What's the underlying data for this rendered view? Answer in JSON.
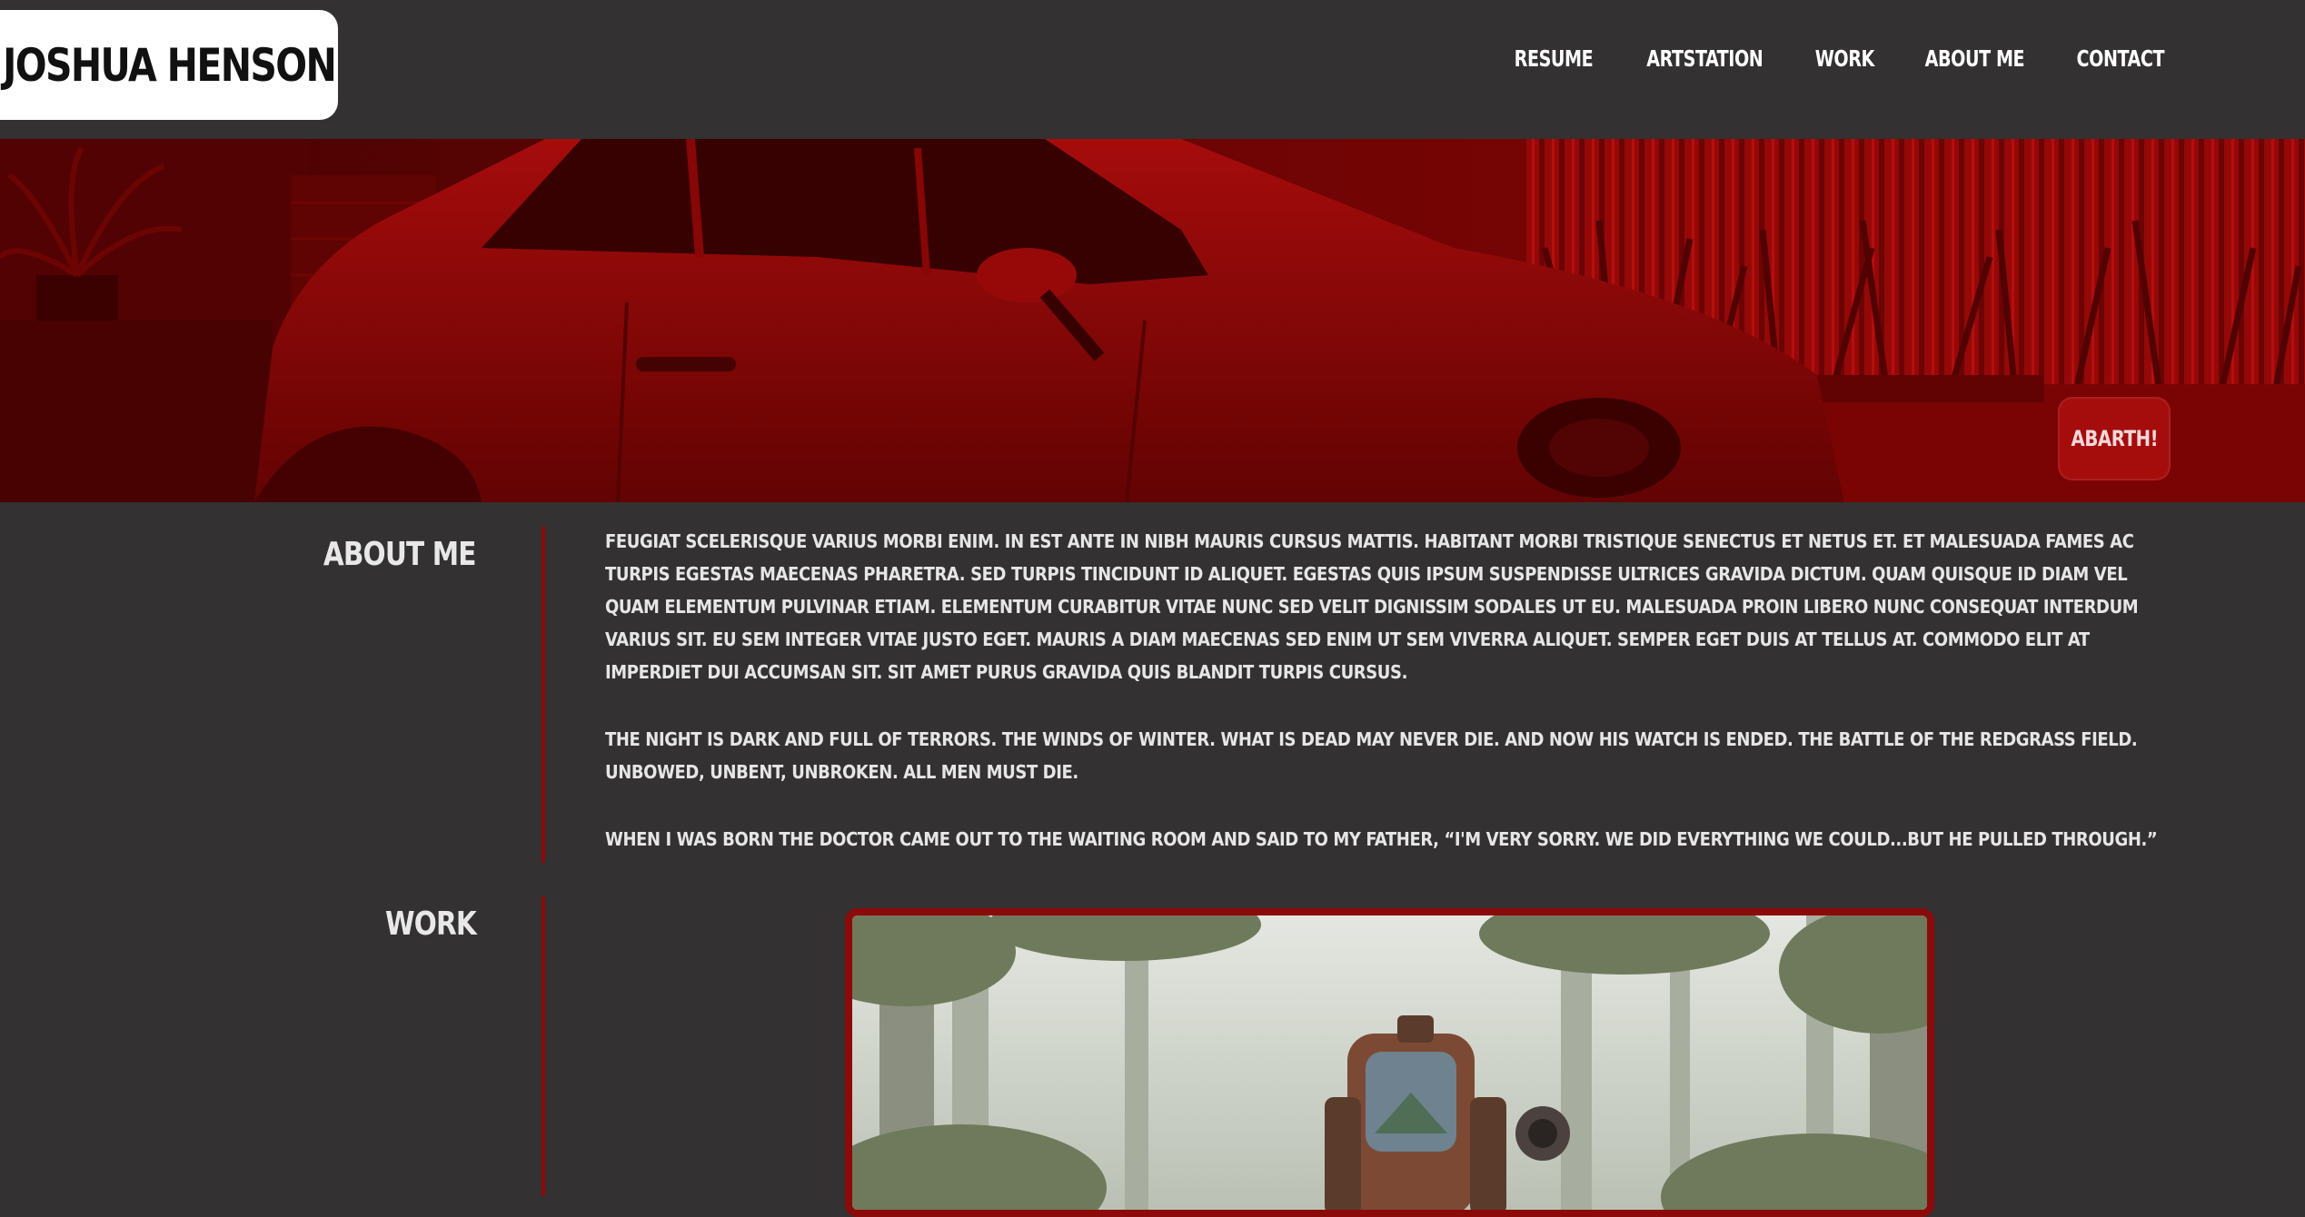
{
  "header": {
    "logo": "JOSHUA HENSON",
    "nav": [
      {
        "label": "RESUME"
      },
      {
        "label": "ARTSTATION"
      },
      {
        "label": "WORK"
      },
      {
        "label": "ABOUT ME"
      },
      {
        "label": "CONTACT"
      }
    ]
  },
  "hero": {
    "badge": "ABARTH!"
  },
  "about": {
    "title": "ABOUT ME",
    "paragraphs": [
      "FEUGIAT SCELERISQUE VARIUS MORBI ENIM. IN EST ANTE IN NIBH MAURIS CURSUS MATTIS. HABITANT MORBI TRISTIQUE SENECTUS ET NETUS ET. ET MALESUADA FAMES AC TURPIS EGESTAS MAECENAS PHARETRA. SED TURPIS TINCIDUNT ID ALIQUET. EGESTAS QUIS IPSUM SUSPENDISSE ULTRICES GRAVIDA DICTUM. QUAM QUISQUE ID DIAM VEL QUAM ELEMENTUM PULVINAR ETIAM. ELEMENTUM CURABITUR VITAE NUNC SED VELIT DIGNISSIM SODALES UT EU. MALESUADA PROIN LIBERO NUNC CONSEQUAT INTERDUM VARIUS SIT. EU SEM INTEGER VITAE JUSTO EGET. MAURIS A DIAM MAECENAS SED ENIM UT SEM VIVERRA ALIQUET. SEMPER EGET DUIS AT TELLUS AT. COMMODO ELIT AT IMPERDIET DUI ACCUMSAN SIT. SIT AMET PURUS GRAVIDA QUIS BLANDIT TURPIS CURSUS.",
      "THE NIGHT IS DARK AND FULL OF TERRORS. THE WINDS OF WINTER. WHAT IS DEAD MAY NEVER DIE. AND NOW HIS WATCH IS ENDED. THE BATTLE OF THE REDGRASS FIELD. UNBOWED, UNBENT, UNBROKEN. ALL MEN MUST DIE.",
      "WHEN I WAS BORN THE DOCTOR CAME OUT TO THE WAITING ROOM AND SAID TO MY FATHER, “I'M VERY SORRY. WE DID EVERYTHING WE COULD...BUT HE PULLED THROUGH.”"
    ]
  },
  "work": {
    "title": "WORK"
  },
  "colors": {
    "background": "#333131",
    "accent": "#8b0a0a",
    "badge": "#a50d0d"
  }
}
